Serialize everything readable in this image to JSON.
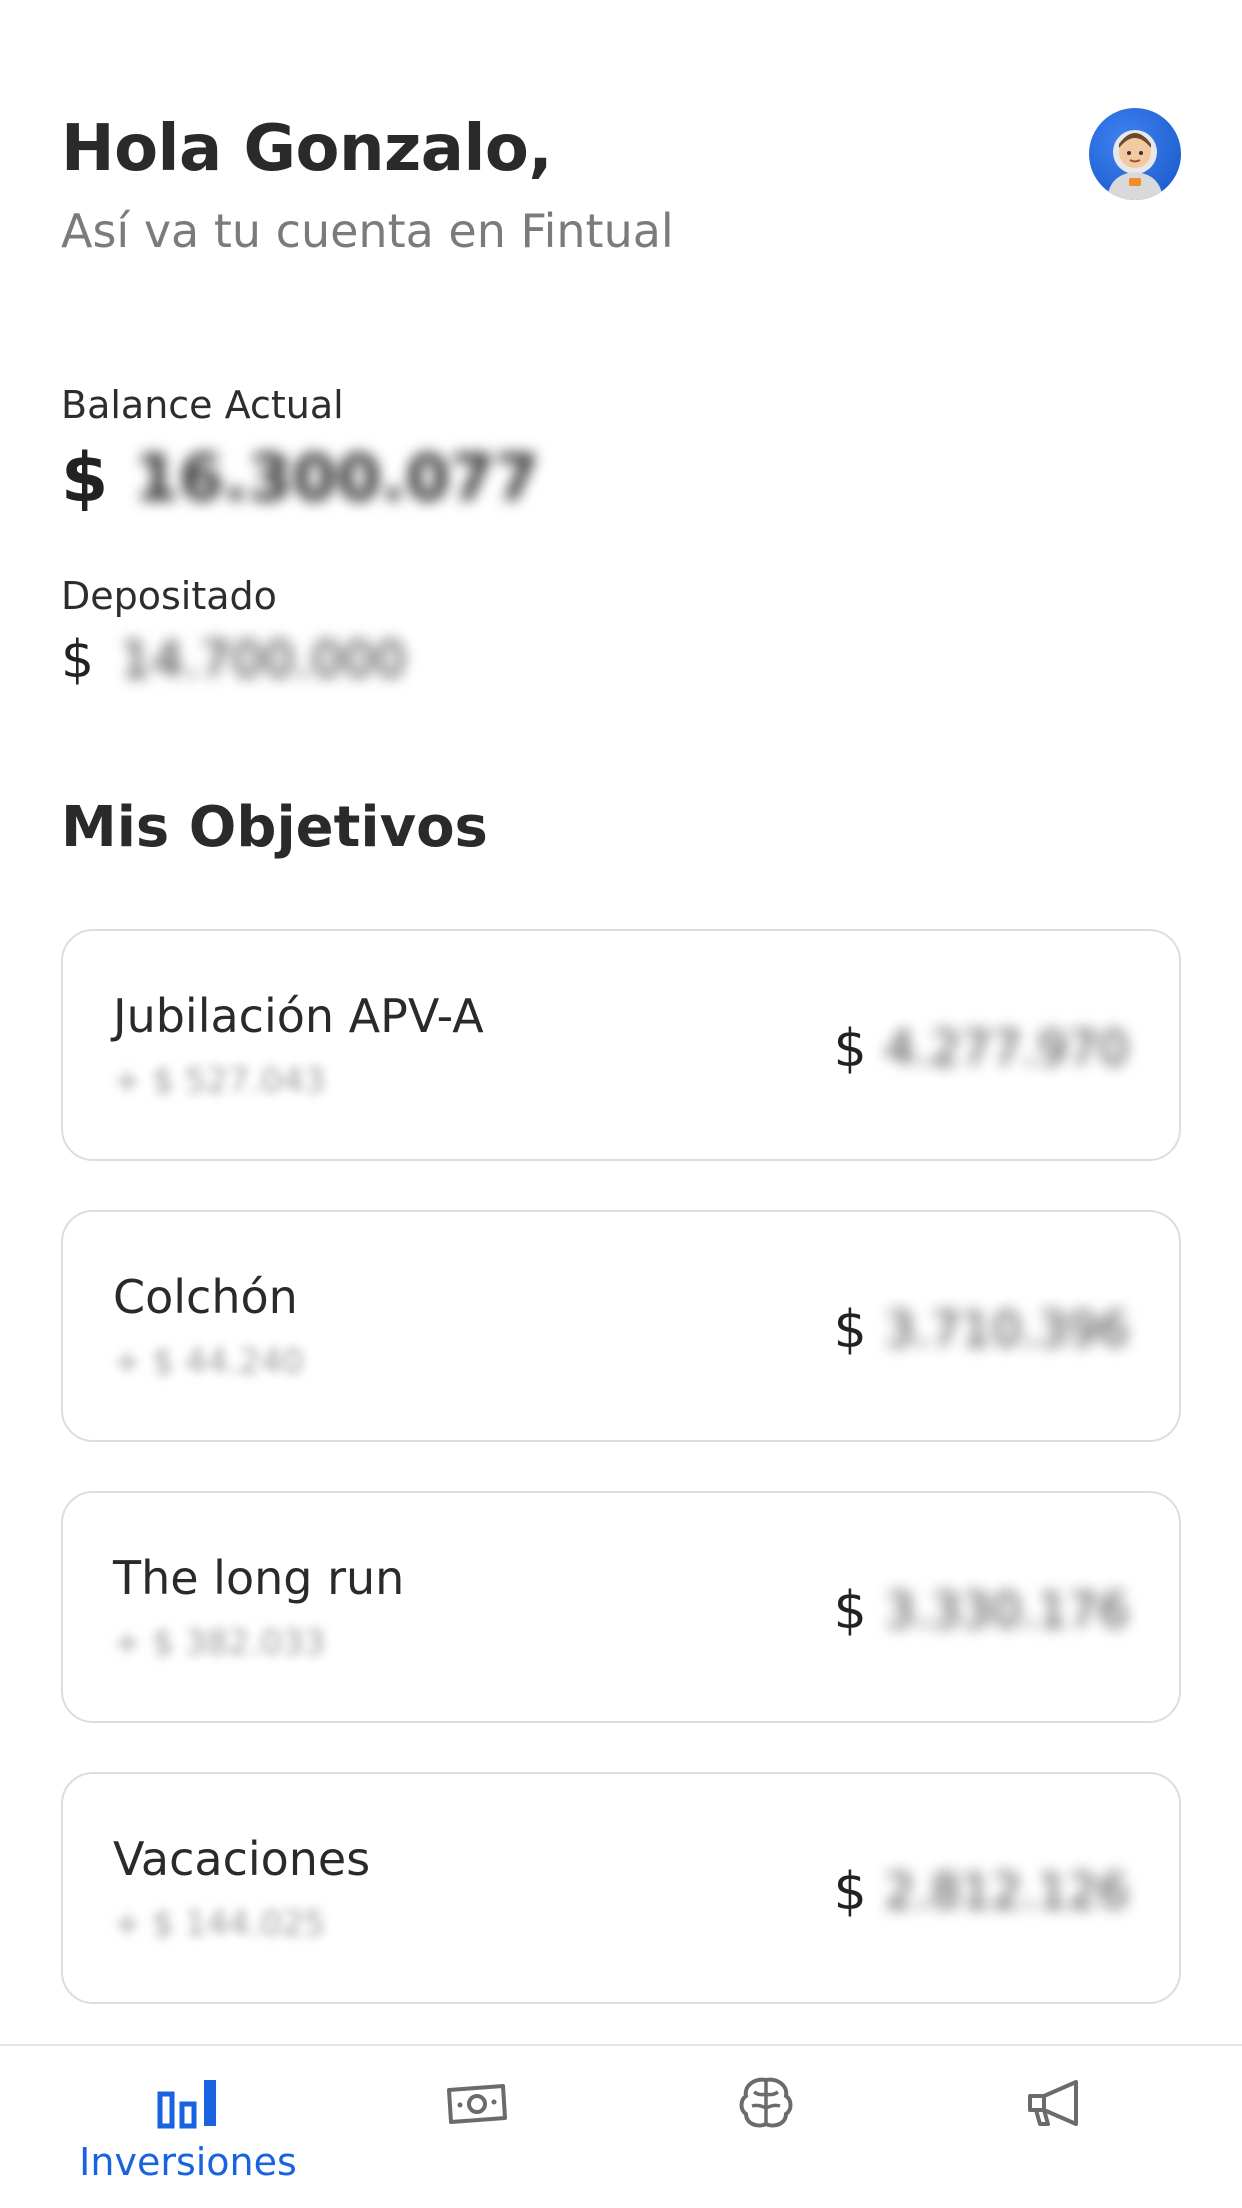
{
  "header": {
    "greeting": "Hola Gonzalo,",
    "subtitle": "Así va tu cuenta en Fintual",
    "avatar_icon": "astronaut-avatar-icon"
  },
  "balance": {
    "label": "Balance Actual",
    "currency": "$",
    "value": "16.300.077"
  },
  "deposited": {
    "label": "Depositado",
    "currency": "$",
    "value": "14.700.000"
  },
  "goals_section": {
    "title": "Mis Objetivos",
    "items": [
      {
        "name": "Jubilación APV-A",
        "gain": "+ $ 527.043",
        "currency": "$",
        "amount": "4.277.970"
      },
      {
        "name": "Colchón",
        "gain": "+ $ 44.240",
        "currency": "$",
        "amount": "3.710.396"
      },
      {
        "name": "The long run",
        "gain": "+ $ 382.033",
        "currency": "$",
        "amount": "3.330.176"
      },
      {
        "name": "Vacaciones",
        "gain": "+ $ 144.025",
        "currency": "$",
        "amount": "2.812.126"
      }
    ]
  },
  "bottom_nav": {
    "active_color": "#1a63e0",
    "inactive_color": "#6b6b6b",
    "items": [
      {
        "icon": "bar-chart-icon",
        "label": "Inversiones",
        "active": true
      },
      {
        "icon": "money-bill-icon",
        "label": "",
        "active": false
      },
      {
        "icon": "brain-icon",
        "label": "",
        "active": false
      },
      {
        "icon": "megaphone-icon",
        "label": "",
        "active": false
      }
    ]
  }
}
